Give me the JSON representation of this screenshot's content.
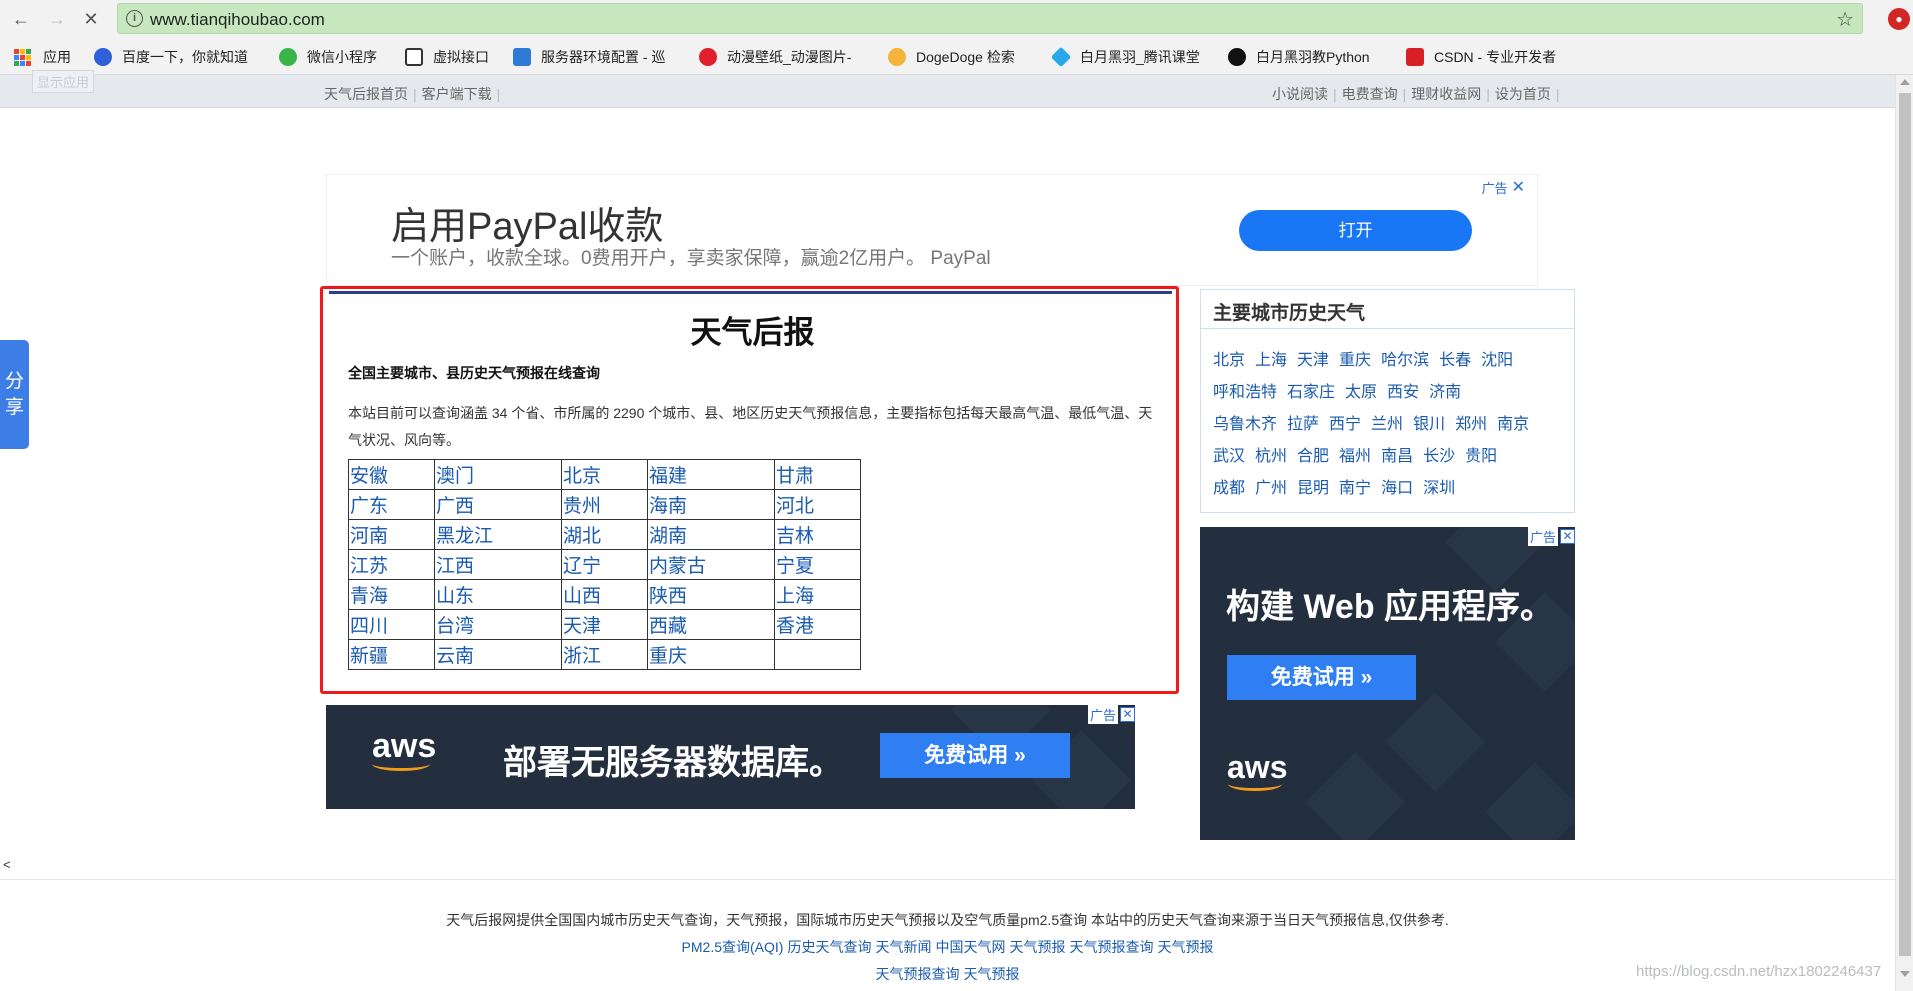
{
  "browser": {
    "url": "www.tianqihoubao.com",
    "bookmarks": [
      {
        "label": "应用",
        "icon": "apps-grid-icon"
      },
      {
        "label": "百度一下，你就知道",
        "icon": "baidu-paw-icon"
      },
      {
        "label": "微信小程序",
        "icon": "wechat-icon"
      },
      {
        "label": "虚拟接口",
        "icon": "mock-api-icon"
      },
      {
        "label": "服务器环境配置 - 巡",
        "icon": "server-icon"
      },
      {
        "label": "动漫壁纸_动漫图片-",
        "icon": "turkey-flag-icon"
      },
      {
        "label": "DogeDoge 检索",
        "icon": "doge-icon"
      },
      {
        "label": "白月黑羽_腾讯课堂",
        "icon": "tencent-class-icon"
      },
      {
        "label": "白月黑羽教Python",
        "icon": "byhy-icon"
      },
      {
        "label": "CSDN - 专业开发者",
        "icon": "csdn-icon"
      }
    ]
  },
  "site_nav": {
    "left": [
      "天气后报首页",
      "客户端下载"
    ],
    "right": [
      "小说阅读",
      "电费查询",
      "理财收益网",
      "设为首页"
    ],
    "show_apps": "显示应用"
  },
  "share": {
    "label1": "分",
    "label2": "享"
  },
  "ad_top": {
    "title": "启用PayPal收款",
    "subtitle": "一个账户，收款全球。0费用开户，享卖家保障，赢逾2亿用户。 PayPal",
    "button": "打开",
    "badge": "广告"
  },
  "main": {
    "title": "天气后报",
    "subtitle": "全国主要城市、县历史天气预报在线查询",
    "description": "本站目前可以查询涵盖 34 个省、市所属的 2290 个城市、县、地区历史天气预报信息，主要指标包括每天最高气温、最低气温、天气状况、风向等。",
    "provinces": [
      [
        "安徽",
        "澳门",
        "北京",
        "福建",
        "甘肃"
      ],
      [
        "广东",
        "广西",
        "贵州",
        "海南",
        "河北"
      ],
      [
        "河南",
        "黑龙江",
        "湖北",
        "湖南",
        "吉林"
      ],
      [
        "江苏",
        "江西",
        "辽宁",
        "内蒙古",
        "宁夏"
      ],
      [
        "青海",
        "山东",
        "山西",
        "陕西",
        "上海"
      ],
      [
        "四川",
        "台湾",
        "天津",
        "西藏",
        "香港"
      ],
      [
        "新疆",
        "云南",
        "浙江",
        "重庆",
        ""
      ]
    ]
  },
  "city_box": {
    "title": "主要城市历史天气",
    "rows": [
      [
        "北京",
        "上海",
        "天津",
        "重庆",
        "哈尔滨",
        "长春",
        "沈阳"
      ],
      [
        "呼和浩特",
        "石家庄",
        "太原",
        "西安",
        "济南"
      ],
      [
        "乌鲁木齐",
        "拉萨",
        "西宁",
        "兰州",
        "银川",
        "郑州",
        "南京"
      ],
      [
        "武汉",
        "杭州",
        "合肥",
        "福州",
        "南昌",
        "长沙",
        "贵阳"
      ],
      [
        "成都",
        "广州",
        "昆明",
        "南宁",
        "海口",
        "深圳"
      ]
    ]
  },
  "ad_right": {
    "title": "构建 Web 应用程序。",
    "button": "免费试用 »",
    "logo": "aws",
    "badge": "广告"
  },
  "ad_bottom": {
    "title": "部署无服务器数据库。",
    "button": "免费试用 »",
    "logo": "aws",
    "badge": "广告"
  },
  "lt_mark": "<",
  "footer": {
    "line1": "天气后报网提供全国国内城市历史天气查询，天气预报，国际城市历史天气预报以及空气质量pm2.5查询 本站中的历史天气查询来源于当日天气预报信息,仅供参考.",
    "links1": [
      "PM2.5查询(AQI)",
      "历史天气查询",
      "天气新闻",
      "中国天气网",
      "天气预报",
      "天气预报查询",
      "天气预报"
    ],
    "links2": [
      "天气预报查询",
      "天气预报"
    ],
    "watermark": "https://blog.csdn.net/hzx1802246437"
  },
  "colors": {
    "accent": "#1976f5",
    "highlight_border": "#ee1a1a",
    "link": "#1a5bb0",
    "aws_bg": "#232f3e"
  }
}
